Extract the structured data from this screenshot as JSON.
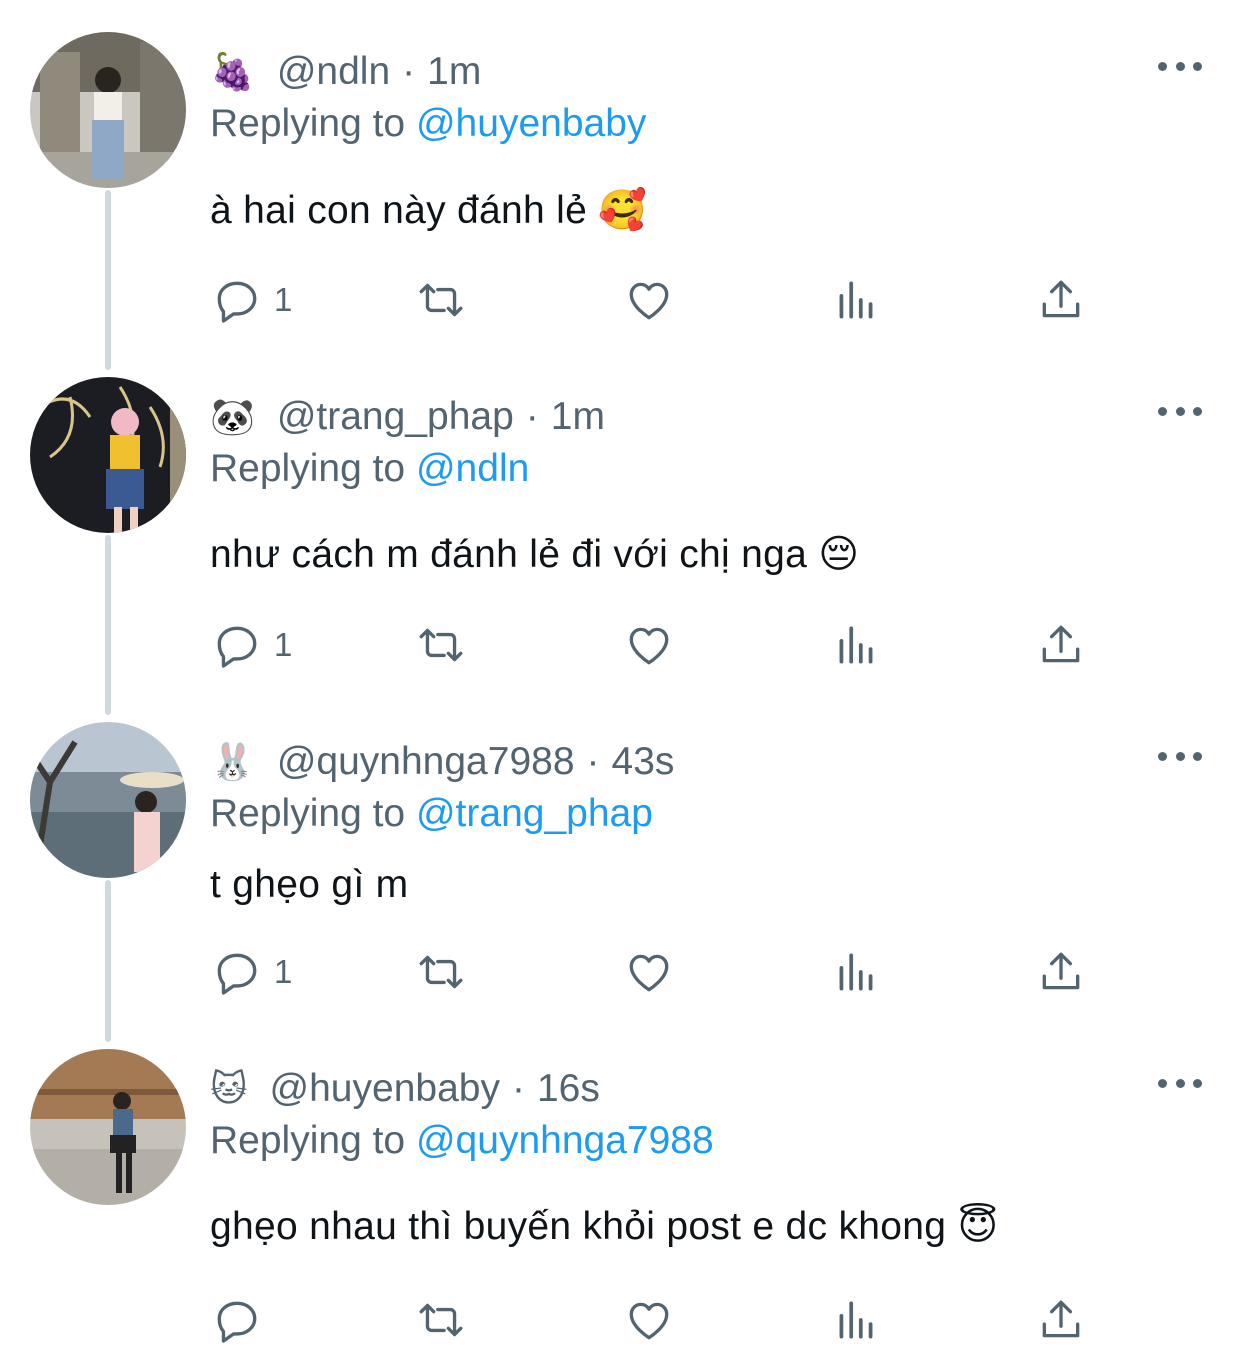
{
  "colors": {
    "muted": "#536471",
    "accent": "#1d9bf0",
    "text": "#0f1419",
    "line": "#cfd9de"
  },
  "tweets": [
    {
      "name_emoji": "🍇",
      "handle": "@ndln",
      "time": "1m",
      "replying_prefix": "Replying to",
      "replying_to": "@huyenbaby",
      "text": "à hai con này đánh lẻ",
      "text_emoji": "🥰",
      "reply_count": "1",
      "icons": [
        "reply-icon",
        "retweet-icon",
        "like-icon",
        "views-icon",
        "share-icon",
        "more-icon"
      ]
    },
    {
      "name_emoji": "🐼",
      "handle": "@trang_phap",
      "time": "1m",
      "replying_prefix": "Replying to",
      "replying_to": "@ndln",
      "text": "như cách m đánh lẻ đi với chị nga",
      "text_emoji": "😔",
      "reply_count": "1",
      "icons": [
        "reply-icon",
        "retweet-icon",
        "like-icon",
        "views-icon",
        "share-icon",
        "more-icon"
      ]
    },
    {
      "name_emoji": "🐰",
      "handle": "@quynhnga7988",
      "time": "43s",
      "replying_prefix": "Replying to",
      "replying_to": "@trang_phap",
      "text": "t ghẹo gì m",
      "text_emoji": "",
      "reply_count": "1",
      "icons": [
        "reply-icon",
        "retweet-icon",
        "like-icon",
        "views-icon",
        "share-icon",
        "more-icon"
      ]
    },
    {
      "name_emoji": "🐱",
      "handle": "@huyenbaby",
      "time": "16s",
      "replying_prefix": "Replying to",
      "replying_to": "@quynhnga7988",
      "text": "ghẹo nhau thì buyến khỏi post e dc khong",
      "text_emoji": "😇",
      "reply_count": "",
      "icons": [
        "reply-icon",
        "retweet-icon",
        "like-icon",
        "views-icon",
        "share-icon",
        "more-icon"
      ]
    }
  ]
}
